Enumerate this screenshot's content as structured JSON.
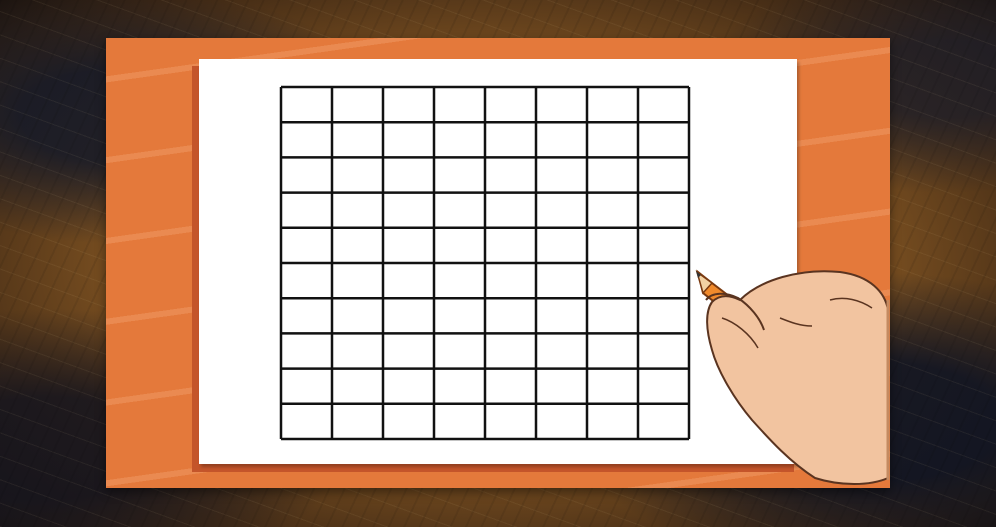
{
  "scene": {
    "background_texture": "scratched-wood-metal",
    "board_color": "#e4793b",
    "paper_color": "#ffffff",
    "grid_line_color": "#111111",
    "grid": {
      "columns": 8,
      "rows": 10
    },
    "icons": [
      "hand-icon",
      "pencil-icon"
    ],
    "pencil_color": "#f08a2c",
    "skin_color": "#f2c4a0"
  }
}
